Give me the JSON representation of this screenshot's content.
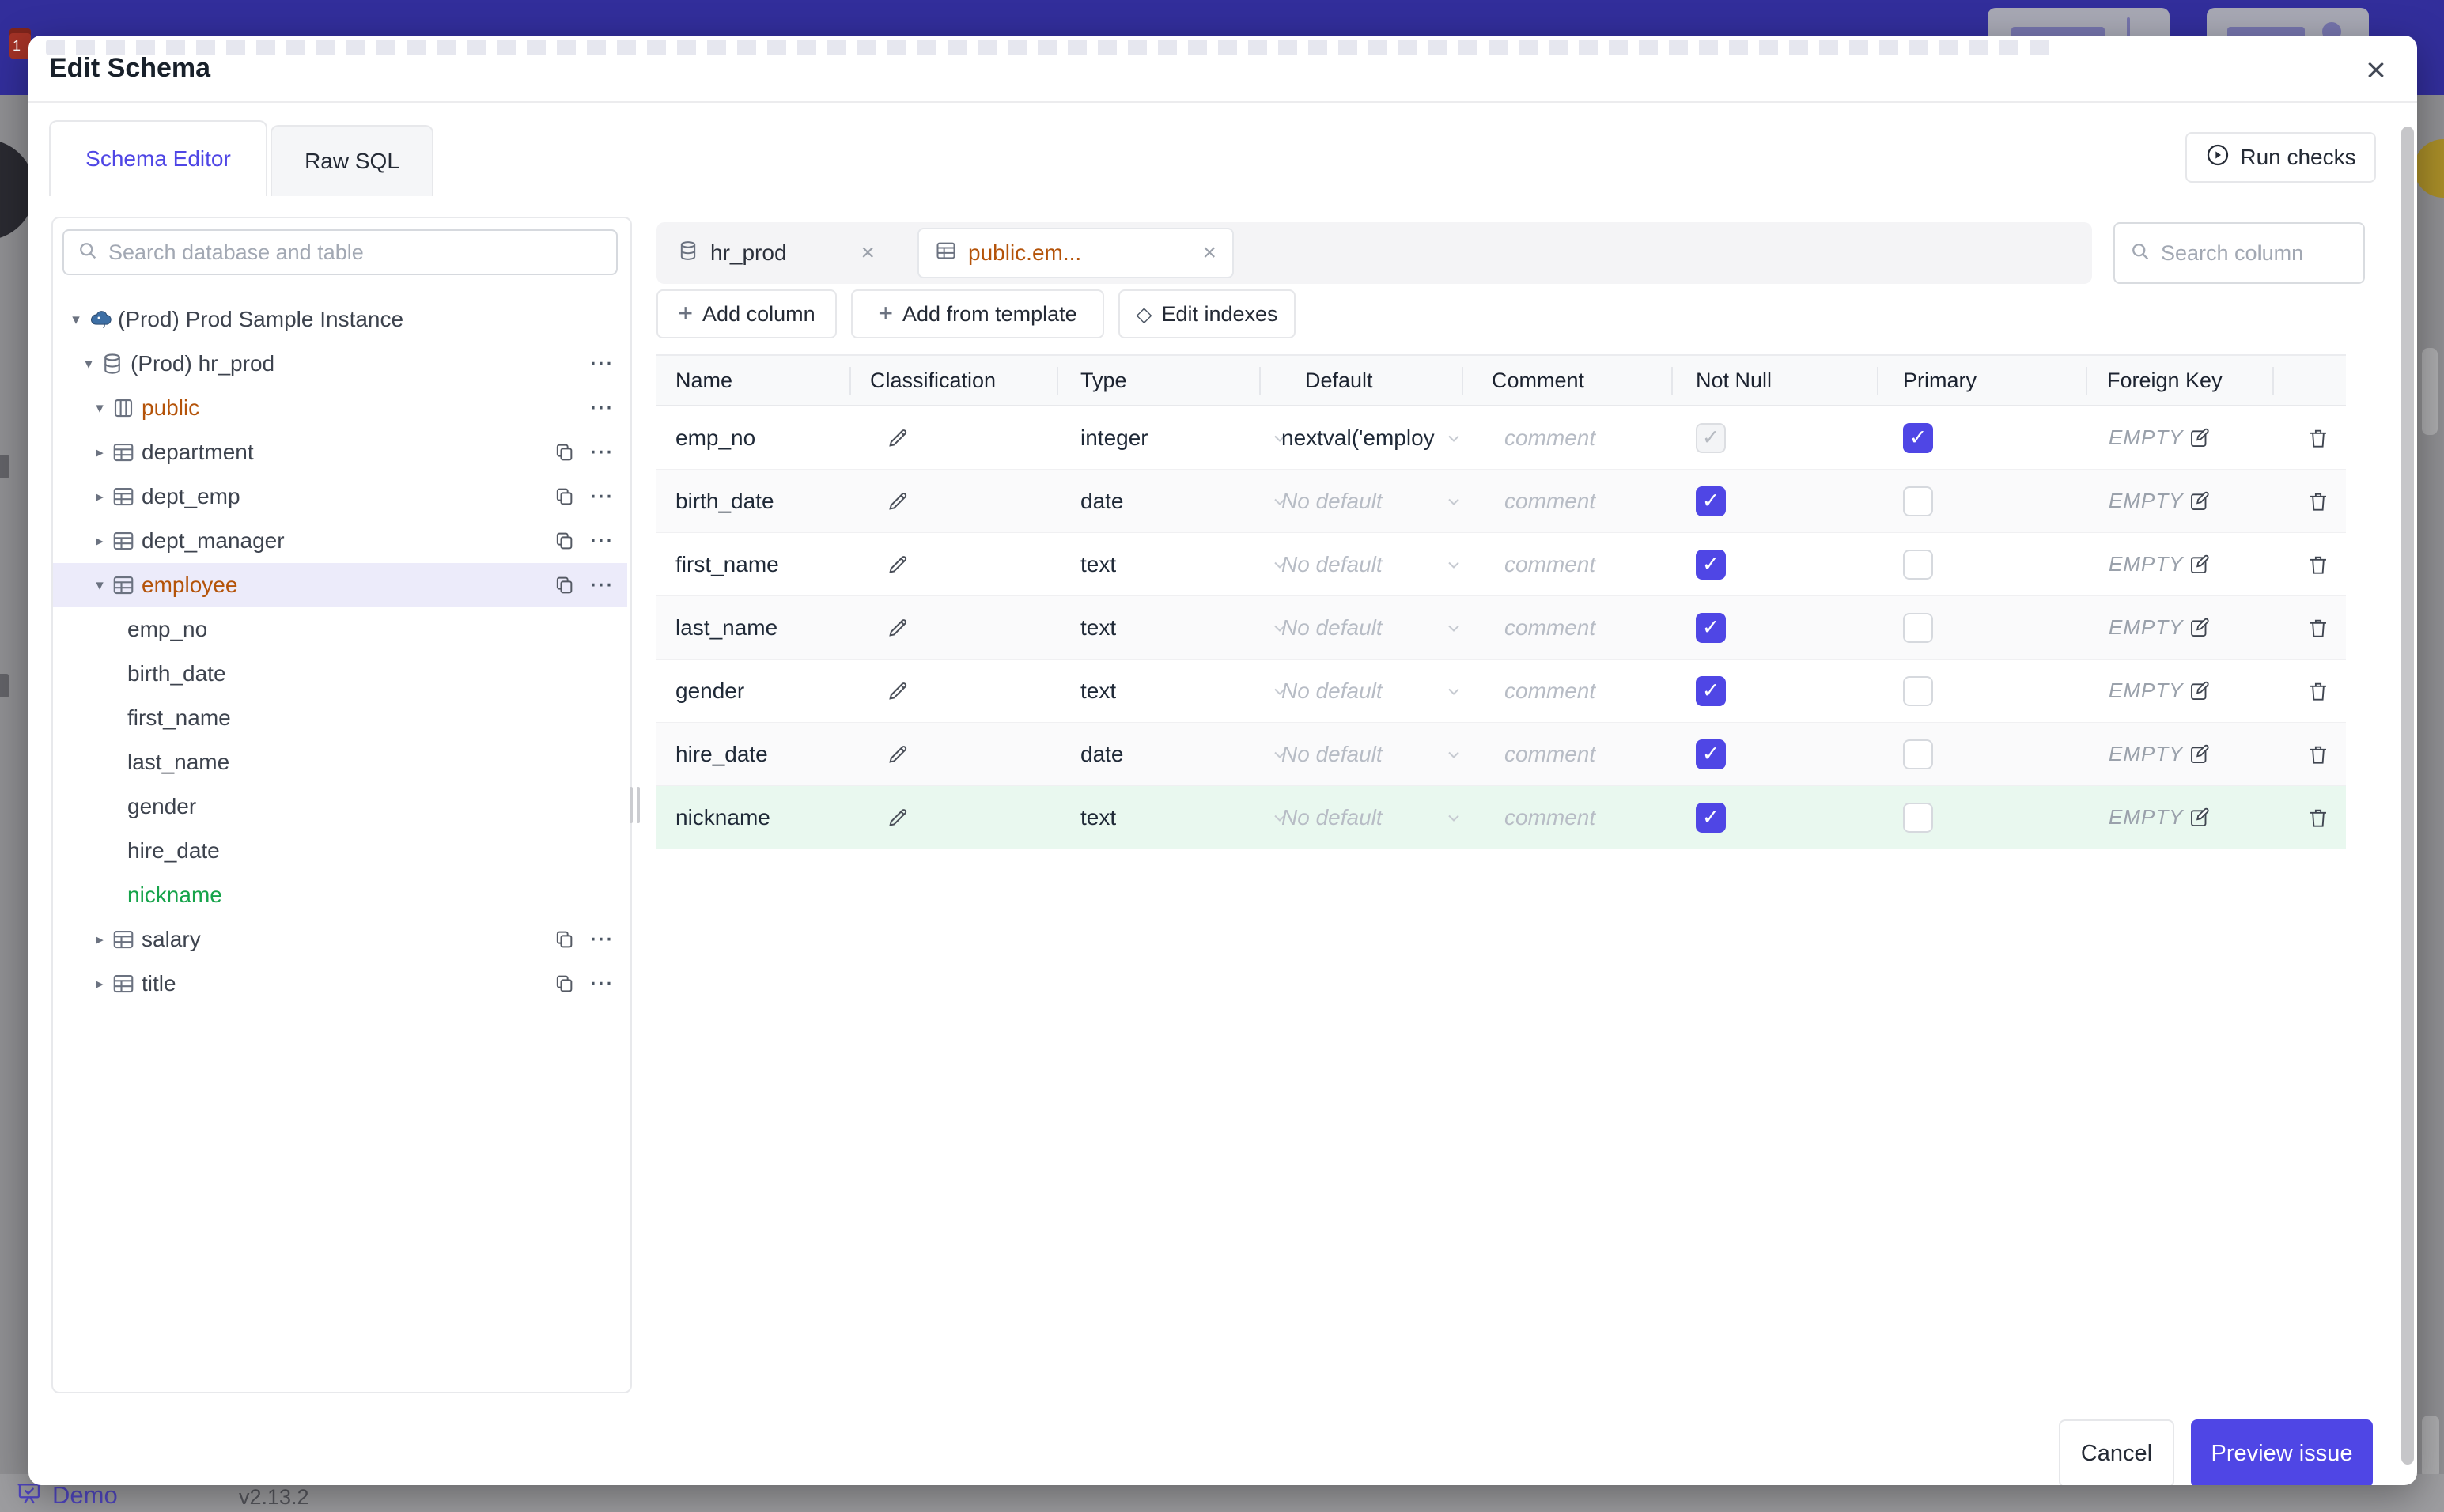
{
  "colors": {
    "accent": "#4f46e5",
    "amber_changed": "#b45309",
    "green_new": "#16a34a",
    "banner": "#322e9b",
    "selected_row_bg": "#ecebfa",
    "new_row_bg": "#e9f8ef"
  },
  "modal": {
    "title": "Edit Schema"
  },
  "tabs": [
    {
      "label": "Schema Editor",
      "active": true
    },
    {
      "label": "Raw SQL",
      "active": false
    }
  ],
  "toolbar": {
    "run_checks_label": "Run checks"
  },
  "sidebar": {
    "search_placeholder": "Search database and table",
    "tree": [
      {
        "level": 0,
        "chevron": "down",
        "icon": "postgres-instance",
        "label": "(Prod) Prod Sample Instance",
        "color": "default",
        "selected": false,
        "trailing": []
      },
      {
        "level": 1,
        "chevron": "down",
        "icon": "database",
        "label": "(Prod) hr_prod",
        "color": "default",
        "selected": false,
        "trailing": [
          "more"
        ]
      },
      {
        "level": 2,
        "chevron": "down",
        "icon": "schema",
        "label": "public",
        "color": "amber",
        "selected": false,
        "trailing": [
          "more"
        ]
      },
      {
        "level": 3,
        "chevron": "right",
        "icon": "table",
        "label": "department",
        "color": "default",
        "selected": false,
        "trailing": [
          "copy",
          "more"
        ]
      },
      {
        "level": 3,
        "chevron": "right",
        "icon": "table",
        "label": "dept_emp",
        "color": "default",
        "selected": false,
        "trailing": [
          "copy",
          "more"
        ]
      },
      {
        "level": 3,
        "chevron": "right",
        "icon": "table",
        "label": "dept_manager",
        "color": "default",
        "selected": false,
        "trailing": [
          "copy",
          "more"
        ]
      },
      {
        "level": 3,
        "chevron": "down",
        "icon": "table",
        "label": "employee",
        "color": "amber",
        "selected": true,
        "trailing": [
          "copy",
          "more"
        ]
      },
      {
        "level": 4,
        "chevron": null,
        "icon": null,
        "label": "emp_no",
        "color": "default",
        "selected": false,
        "trailing": []
      },
      {
        "level": 4,
        "chevron": null,
        "icon": null,
        "label": "birth_date",
        "color": "default",
        "selected": false,
        "trailing": []
      },
      {
        "level": 4,
        "chevron": null,
        "icon": null,
        "label": "first_name",
        "color": "default",
        "selected": false,
        "trailing": []
      },
      {
        "level": 4,
        "chevron": null,
        "icon": null,
        "label": "last_name",
        "color": "default",
        "selected": false,
        "trailing": []
      },
      {
        "level": 4,
        "chevron": null,
        "icon": null,
        "label": "gender",
        "color": "default",
        "selected": false,
        "trailing": []
      },
      {
        "level": 4,
        "chevron": null,
        "icon": null,
        "label": "hire_date",
        "color": "default",
        "selected": false,
        "trailing": []
      },
      {
        "level": 4,
        "chevron": null,
        "icon": null,
        "label": "nickname",
        "color": "green",
        "selected": false,
        "trailing": []
      },
      {
        "level": 3,
        "chevron": "right",
        "icon": "table",
        "label": "salary",
        "color": "default",
        "selected": false,
        "trailing": [
          "copy",
          "more"
        ]
      },
      {
        "level": 3,
        "chevron": "right",
        "icon": "table",
        "label": "title",
        "color": "default",
        "selected": false,
        "trailing": [
          "copy",
          "more"
        ]
      }
    ]
  },
  "editor": {
    "chips": [
      {
        "icon": "database",
        "label": "hr_prod",
        "active": false
      },
      {
        "icon": "table",
        "label": "public.em...",
        "active": true
      }
    ],
    "column_search_placeholder": "Search column",
    "actions": [
      {
        "icon": "plus",
        "label": "Add column"
      },
      {
        "icon": "plus",
        "label": "Add from template"
      },
      {
        "icon": "diamond",
        "label": "Edit indexes"
      }
    ],
    "table": {
      "headers": [
        "Name",
        "Classification",
        "Type",
        "Default",
        "Comment",
        "Not Null",
        "Primary",
        "Foreign Key"
      ],
      "comment_placeholder": "comment",
      "foreign_key_placeholder": "EMPTY",
      "rows": [
        {
          "name": "emp_no",
          "type": "integer",
          "default": "nextval('employ",
          "default_muted": false,
          "not_null_checked": true,
          "not_null_disabled": true,
          "primary": true,
          "new": false
        },
        {
          "name": "birth_date",
          "type": "date",
          "default": "No default",
          "default_muted": true,
          "not_null_checked": true,
          "not_null_disabled": false,
          "primary": false,
          "new": false
        },
        {
          "name": "first_name",
          "type": "text",
          "default": "No default",
          "default_muted": true,
          "not_null_checked": true,
          "not_null_disabled": false,
          "primary": false,
          "new": false
        },
        {
          "name": "last_name",
          "type": "text",
          "default": "No default",
          "default_muted": true,
          "not_null_checked": true,
          "not_null_disabled": false,
          "primary": false,
          "new": false
        },
        {
          "name": "gender",
          "type": "text",
          "default": "No default",
          "default_muted": true,
          "not_null_checked": true,
          "not_null_disabled": false,
          "primary": false,
          "new": false
        },
        {
          "name": "hire_date",
          "type": "date",
          "default": "No default",
          "default_muted": true,
          "not_null_checked": true,
          "not_null_disabled": false,
          "primary": false,
          "new": false
        },
        {
          "name": "nickname",
          "type": "text",
          "default": "No default",
          "default_muted": true,
          "not_null_checked": true,
          "not_null_disabled": false,
          "primary": false,
          "new": true
        }
      ]
    }
  },
  "footer": {
    "cancel_label": "Cancel",
    "submit_label": "Preview issue"
  },
  "page_behind": {
    "brand": "Demo",
    "version": "v2.13.2"
  },
  "icons": {
    "search-icon": "magnifier",
    "close-icon": "×",
    "chevron-down-icon": "v",
    "tree-expand-icon": "▾",
    "tree-collapse-icon": "▸",
    "more-icon": "⋯",
    "copy-icon": "two-rects",
    "pencil-icon": "pencil",
    "trash-icon": "trash",
    "edit-square-icon": "pencil-in-square",
    "play-circle-icon": "circled-play",
    "plus-icon": "+",
    "diamond-icon": "◇",
    "database-icon": "cylinder",
    "table-icon": "grid",
    "schema-icon": "columns",
    "postgres-icon": "elephant",
    "presentation-icon": "board"
  }
}
